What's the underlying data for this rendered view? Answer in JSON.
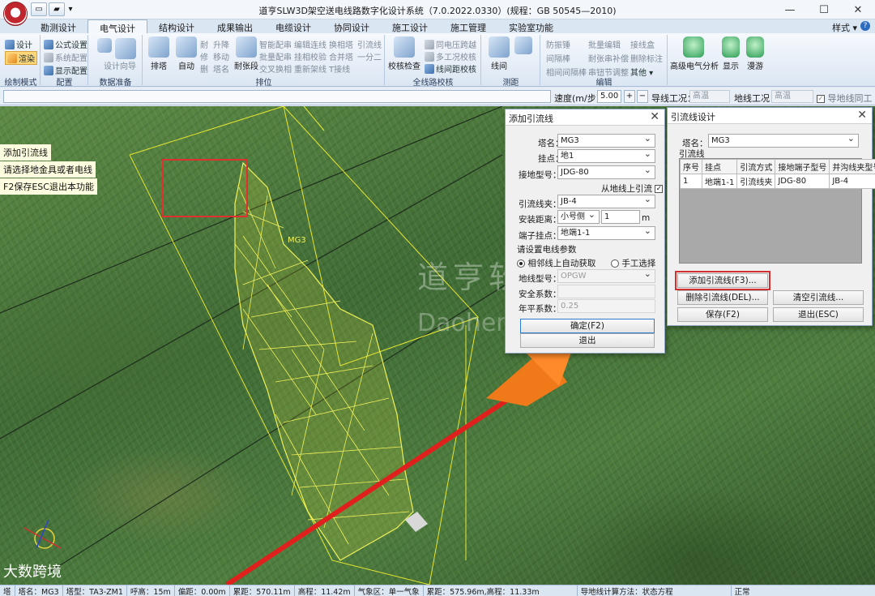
{
  "window": {
    "title": "道亨SLW3D架空送电线路数字化设计系统（7.0.2022.0330）(规程：GB 50545—2010)",
    "controls": [
      "—",
      "☐",
      "✕"
    ]
  },
  "ribbon": {
    "tabs": [
      "勘测设计",
      "电气设计",
      "结构设计",
      "成果输出",
      "电缆设计",
      "协同设计",
      "施工设计",
      "施工管理",
      "实验室功能"
    ],
    "active_tab": "电气设计",
    "style_menu": "样式 ▾",
    "groups": {
      "draw_mode": {
        "label": "绘制模式",
        "items": [
          "设计",
          "渲染"
        ]
      },
      "config": {
        "label": "配置",
        "items": [
          "公式设置",
          "系统配置",
          "显示配置"
        ]
      },
      "data_prep": {
        "label": "数据准备",
        "items": [
          "设计向导"
        ]
      },
      "layout": {
        "label": "排位",
        "big_items": [
          "排塔",
          "自动",
          "耐张段"
        ],
        "small_col1": [
          "耐",
          "修",
          "删"
        ],
        "small_col2": [
          "升降",
          "移动",
          "塔名"
        ],
        "small_col3": [
          "智能配串",
          "批量配串",
          "交叉换相"
        ],
        "small_col4": [
          "编辑连线",
          "挂相校验",
          "重新架线"
        ],
        "small_col5": [
          "换相塔",
          "合并塔",
          "T接线"
        ],
        "small_col6": [
          "引流线",
          "一分二"
        ]
      },
      "check": {
        "label": "全线路校核",
        "big_items": [
          "校核检查"
        ],
        "small": [
          "同电压跨越",
          "多工况校核",
          "线间距校核"
        ]
      },
      "measure": {
        "label": "测距",
        "big_items": [
          "线间"
        ]
      },
      "edit": {
        "label": "编辑",
        "col1": [
          "防振锤",
          "间隔棒",
          "相间间隔棒"
        ],
        "col2": [
          "批量编辑",
          "耐张串补偿",
          "串钮节调整"
        ],
        "col3": [
          "接线盒",
          "删除标注",
          "其他 ▾"
        ]
      },
      "extra": [
        "高级电气分析",
        "显示",
        "漫游"
      ]
    }
  },
  "toolbar": {
    "speed_label": "速度(m/步)：",
    "speed_value": "5.00",
    "plus": "+",
    "minus": "−",
    "conductor_condition_label": "导线工况：",
    "conductor_condition_value": "高温",
    "ground_condition_label": "地线工况：",
    "ground_condition_value": "高温",
    "sync_label": "导地线同工况"
  },
  "viewport": {
    "hints": [
      "添加引流线",
      "请选择地金具或者电线",
      "F2保存ESC退出本功能"
    ],
    "tower_tag": "MG3",
    "watermark_cn": "道亨软件",
    "watermark_en": "Daoheng INC.",
    "corner_logo": "大数跨境"
  },
  "add_jumper_dialog": {
    "title": "添加引流线",
    "tower_label": "塔名：",
    "tower_value": "MG3",
    "hang_label": "挂点：",
    "hang_value": "地1",
    "clamp_label": "接地型号：",
    "clamp_value": "JDG-80",
    "from_ground": "从地线上引流",
    "jumper_clamp_label": "引流线夹：",
    "jumper_clamp_value": "JB-4",
    "install_label": "安装距离：",
    "install_side": "小号侧",
    "install_value": "1",
    "install_unit": "m",
    "end_label": "端子挂点：",
    "end_value": "地端1-1",
    "params_legend": "请设置电线参数",
    "radio_auto": "相邻线上自动获取",
    "radio_manual": "手工选择",
    "wire_type_label": "地线型号：",
    "wire_type_value": "OPGW",
    "safety_label": "安全系数：",
    "safety_value": "",
    "annual_label": "年平系数：",
    "annual_value": "0.25",
    "ok": "确定(F2)",
    "exit": "退出"
  },
  "jumper_design_dialog": {
    "title": "引流线设计",
    "tower_label": "塔名：",
    "tower_value": "MG3",
    "section_label": "引流线",
    "columns": [
      "序号",
      "挂点",
      "引流方式",
      "接地端子型号",
      "并沟线夹型号"
    ],
    "rows": [
      [
        "1",
        "地端1-1",
        "引流线夹",
        "JDG-80",
        "JB-4"
      ]
    ],
    "add": "添加引流线(F3)...",
    "delete": "删除引流线(DEL)...",
    "clear": "清空引流线...",
    "save": "保存(F2)",
    "exit": "退出(ESC)"
  },
  "status_bar": [
    "塔",
    "塔名：MG3",
    "塔型：TA3-ZM1",
    "呼高：15m",
    "偏距：0.00m",
    "累距：570.11m",
    "高程：11.42m",
    "气象区：单一气象",
    "累距：575.96m,高程：11.33m",
    "导地线计算方法：状态方程",
    "正常"
  ]
}
